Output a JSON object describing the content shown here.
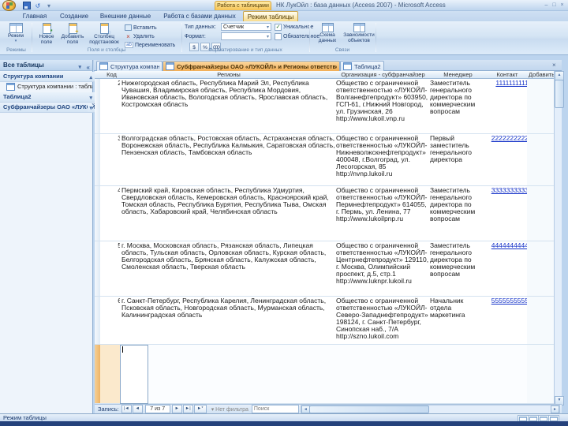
{
  "window": {
    "title": "НК ЛукОйл : база данных (Access 2007) - Microsoft Access",
    "contextual_group": "Работа с таблицами"
  },
  "ribbon": {
    "tabs": [
      "Главная",
      "Создание",
      "Внешние данные",
      "Работа с базами данных",
      "Режим таблицы"
    ],
    "active_tab": "Режим таблицы",
    "view_group": {
      "label": "Режимы",
      "view_button": "Режим"
    },
    "fields_group": {
      "label": "Поля и столбцы",
      "new_field": "Новое поле",
      "add_fields": "Добавить поля",
      "lookup_column": "Столбец подстановок",
      "insert": "Вставить",
      "delete": "Удалить",
      "rename": "Переименовать"
    },
    "format_group": {
      "label": "Форматирование и тип данных",
      "data_type_label": "Тип данных:",
      "data_type_value": "Счетчик",
      "format_label": "Формат:",
      "format_value": "",
      "unique_label": "Уникальное",
      "unique_check": "✓",
      "required_label": "Обязательное",
      "required_check": "",
      "currency": "$",
      "percent": "%",
      "thousands": "000"
    },
    "relations_group": {
      "label": "Связи",
      "relationships": "Схема данных",
      "dependencies": "Зависимости объектов"
    }
  },
  "nav_pane": {
    "title": "Все таблицы",
    "groups": [
      {
        "label": "Структура компании",
        "items": [
          "Структура компании : таблица"
        ]
      },
      {
        "label": "Таблица2",
        "items": []
      },
      {
        "label": "Субфранчайзеры ОАО «ЛУКОЙЛ» и Регионы ответственности",
        "items": []
      }
    ]
  },
  "doc_tabs": [
    "Структура компании",
    "Субфранчайзеры ОАО «ЛУКОЙЛ» и Регионы ответственности",
    "Таблица2"
  ],
  "active_doc_tab": "Субфранчайзеры ОАО «ЛУКОЙЛ» и Регионы ответственности",
  "table": {
    "columns": [
      "Код",
      "Регионы",
      "Организация - субфранчайзер",
      "Менеджер",
      "Контакт",
      "Добавить поле"
    ],
    "rows": [
      {
        "id": "2",
        "regions": "Нижегородская область, Республика Марий Эл, Республика Чувашия, Владимирская область, Республика Мордовия, Ивановская область, Вологодская область, Ярославская область, Костромская область",
        "organization": "Общество с ограниченной ответственностью «ЛУКОЙЛ-Волганефтепродукт» 603950, ГСП-61, г.Нижний Новгород, ул. Грузинская, 26 http://www.lukoil.vnp.ru",
        "manager": "Заместитель генерального директора по коммерческим вопросам",
        "contact": "1111111111"
      },
      {
        "id": "3",
        "regions": "Волгоградская область, Ростовская область, Астраханская область, Воронежская область, Республика Калмыкия, Саратовская область, Пензенская область, Тамбовская область",
        "organization": "Общество с ограниченной ответственностью «ЛУКОЙЛ-Нижневолжскнефтепродукт» 400048, г.Волгоград, ул. Лесогорская, 85 http://nvnp.lukoil.ru",
        "manager": "Первый заместитель генерального директора",
        "contact": "2222222222"
      },
      {
        "id": "4",
        "regions": "Пермский край, Кировская область, Республика Удмуртия, Свердловская область, Кемеровская область, Красноярский край, Томская область, Республика Бурятия, Республика Тыва, Омская область, Хабаровский край, Челябинская область",
        "organization": "Общество с ограниченной ответственностью «ЛУКОЙЛ-Пермнефтепродукт» 614055, г. Пермь, ул. Ленина, 77 http://www.lukoilpnp.ru",
        "manager": "Заместитель генерального директора по коммерческим вопросам",
        "contact": "3333333333"
      },
      {
        "id": "5",
        "regions": "г. Москва, Московская область, Рязанская область, Липецкая область, Тульская область, Орловская область, Курская область, Белгородская область, Брянская область, Калужская область, Смоленская область, Тверская область",
        "organization": "Общество с ограниченной ответственностью «ЛУКОЙЛ-Центрнефтепродукт» 129110, г. Москва, Олимпийский проспект, д.5, стр.1 http://www.luknpr.lukoil.ru",
        "manager": "Заместитель генерального директора по коммерческим вопросам",
        "contact": "4444444444"
      },
      {
        "id": "6",
        "regions": "г. Санкт-Петербург, Республика Карелия, Ленинградская область, Псковская область, Новгородская область, Мурманская область, Калининградская область",
        "organization": "Общество с ограниченной ответственностью «ЛУКОЙЛ-Северо-Западнефтепродукт» 198124, г. Санкт-Петербург, Синопская наб., 7/А http://szno.lukoil.com",
        "manager": "Начальник отдела маркетинга",
        "contact": "5555555555"
      }
    ]
  },
  "record_navigator": {
    "label": "Запись:",
    "position": "7 из 7",
    "filter_state": "Нет фильтра",
    "search_placeholder": "Поиск"
  },
  "status_bar": {
    "view_label": "Режим таблицы"
  },
  "icons": {
    "dropdown": "▾",
    "collapse": "«",
    "chev_up": "▴",
    "chev_down": "▾",
    "undo": "↺",
    "close": "×",
    "minimize": "–",
    "maximize": "□",
    "up": "▲",
    "down": "▼",
    "left": "◄",
    "right": "►",
    "first": "|◄",
    "prev": "◄",
    "next": "►",
    "last": "►|",
    "new_rec": "►*"
  }
}
